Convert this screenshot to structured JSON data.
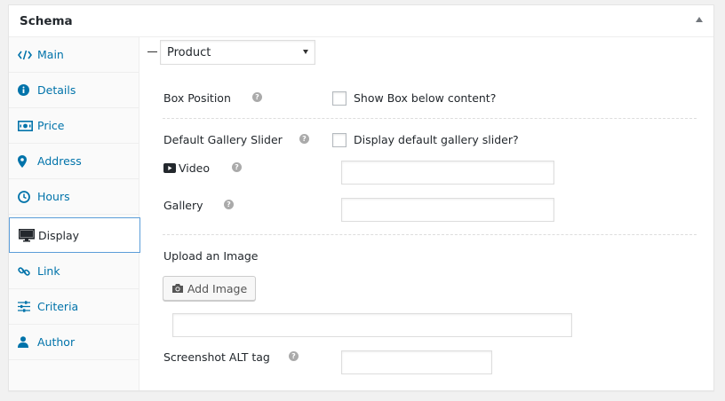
{
  "metabox": {
    "title": "Schema",
    "toggle_icon": "arrow-up-icon"
  },
  "sidebar": {
    "items": [
      {
        "label": "Main",
        "icon": "code-icon"
      },
      {
        "label": "Details",
        "icon": "info-circle-icon"
      },
      {
        "label": "Price",
        "icon": "money-icon"
      },
      {
        "label": "Address",
        "icon": "map-marker-icon"
      },
      {
        "label": "Hours",
        "icon": "clock-icon"
      },
      {
        "label": "Display",
        "icon": "desktop-icon",
        "active": true
      },
      {
        "label": "Link",
        "icon": "link-icon"
      },
      {
        "label": "Criteria",
        "icon": "sliders-icon"
      },
      {
        "label": "Author",
        "icon": "user-icon"
      }
    ]
  },
  "main": {
    "type_select": {
      "value": "Product"
    },
    "box_position": {
      "label": "Box Position",
      "checkbox_label": "Show Box below content?",
      "checked": false
    },
    "gallery_slider": {
      "label": "Default Gallery Slider",
      "checkbox_label": "Display default gallery slider?",
      "checked": false
    },
    "video": {
      "label": "Video",
      "value": ""
    },
    "gallery": {
      "label": "Gallery",
      "value": ""
    },
    "upload": {
      "label": "Upload an Image",
      "button_label": "Add Image",
      "url_value": ""
    },
    "alt_tag": {
      "label": "Screenshot ALT tag",
      "value": ""
    },
    "help_glyph": "?"
  },
  "colors": {
    "link": "#0073aa",
    "active_border": "#5b9dd9",
    "help_icon": "#aaaaaa"
  }
}
